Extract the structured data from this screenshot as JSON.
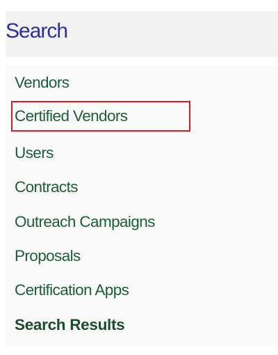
{
  "header": {
    "title": "Search"
  },
  "menu": {
    "items": [
      {
        "label": "Vendors"
      },
      {
        "label": "Certified Vendors"
      },
      {
        "label": "Users"
      },
      {
        "label": "Contracts"
      },
      {
        "label": "Outreach Campaigns"
      },
      {
        "label": "Proposals"
      },
      {
        "label": "Certification Apps"
      },
      {
        "label": "Search Results"
      }
    ],
    "active_item": "Search Results",
    "highlighted_item": "Certified Vendors"
  },
  "colors": {
    "header_text": "#2c2fa0",
    "link_text": "#1b5e3a",
    "highlight_border": "#e8141b",
    "header_background": "#f2f2f2"
  }
}
